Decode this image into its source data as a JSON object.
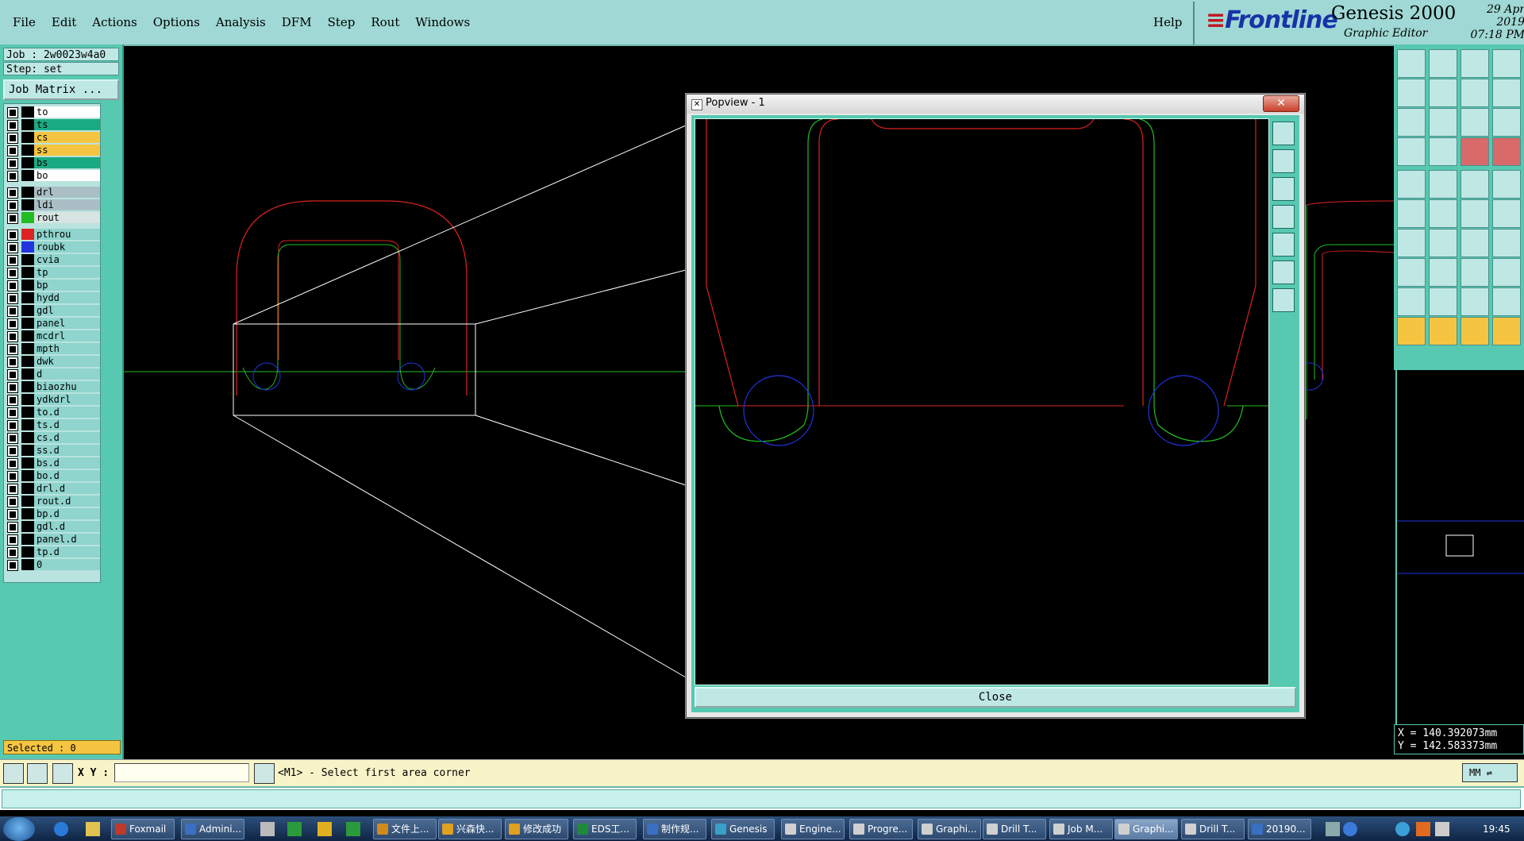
{
  "menubar": {
    "items": [
      {
        "label": "File"
      },
      {
        "label": "Edit"
      },
      {
        "label": "Actions"
      },
      {
        "label": "Options"
      },
      {
        "label": "Analysis"
      },
      {
        "label": "DFM"
      },
      {
        "label": "Step"
      },
      {
        "label": "Rout"
      },
      {
        "label": "Windows"
      }
    ],
    "help": "Help"
  },
  "brand": {
    "logo": "Frontline",
    "product": "Genesis 2000",
    "subtitle": "Graphic Editor",
    "date": "29 Apr 2019",
    "time": "07:18 PM"
  },
  "left": {
    "job": "Job : 2w0023w4a0",
    "step": "Step: set",
    "job_matrix": "Job Matrix ...",
    "layers": [
      {
        "name": "to",
        "bg": "#ffffff",
        "color": "#000000"
      },
      {
        "name": "ts",
        "bg": "#1aaa82",
        "color": "#000000"
      },
      {
        "name": "cs",
        "bg": "#f5c542",
        "color": "#000000"
      },
      {
        "name": "ss",
        "bg": "#f5c542",
        "color": "#000000"
      },
      {
        "name": "bs",
        "bg": "#1aaa82",
        "color": "#000000"
      },
      {
        "name": "bo",
        "bg": "#ffffff",
        "color": "#000000"
      },
      {
        "name": "drl",
        "bg": "#a9bfc5",
        "color": "#000000"
      },
      {
        "name": "ldi",
        "bg": "#a9bfc5",
        "color": "#000000"
      },
      {
        "name": "rout",
        "bg": "#d8e4e2",
        "color": "#22bb22"
      },
      {
        "name": "pthrou",
        "bg": "#8fd4cd",
        "color": "#dd2222"
      },
      {
        "name": "roubk",
        "bg": "#8fd4cd",
        "color": "#2233dd"
      },
      {
        "name": "cvia",
        "bg": "#8fd4cd",
        "color": "#000000"
      },
      {
        "name": "tp",
        "bg": "#8fd4cd",
        "color": "#000000"
      },
      {
        "name": "bp",
        "bg": "#8fd4cd",
        "color": "#000000"
      },
      {
        "name": "hydd",
        "bg": "#8fd4cd",
        "color": "#000000"
      },
      {
        "name": "gdl",
        "bg": "#8fd4cd",
        "color": "#000000"
      },
      {
        "name": "panel",
        "bg": "#8fd4cd",
        "color": "#000000"
      },
      {
        "name": "mcdrl",
        "bg": "#8fd4cd",
        "color": "#000000"
      },
      {
        "name": "mpth",
        "bg": "#8fd4cd",
        "color": "#000000"
      },
      {
        "name": "dwk",
        "bg": "#8fd4cd",
        "color": "#000000"
      },
      {
        "name": "d",
        "bg": "#8fd4cd",
        "color": "#000000"
      },
      {
        "name": "biaozhu",
        "bg": "#8fd4cd",
        "color": "#000000"
      },
      {
        "name": "ydkdrl",
        "bg": "#8fd4cd",
        "color": "#000000"
      },
      {
        "name": "to.d",
        "bg": "#8fd4cd",
        "color": "#000000"
      },
      {
        "name": "ts.d",
        "bg": "#8fd4cd",
        "color": "#000000"
      },
      {
        "name": "cs.d",
        "bg": "#8fd4cd",
        "color": "#000000"
      },
      {
        "name": "ss.d",
        "bg": "#8fd4cd",
        "color": "#000000"
      },
      {
        "name": "bs.d",
        "bg": "#8fd4cd",
        "color": "#000000"
      },
      {
        "name": "bo.d",
        "bg": "#8fd4cd",
        "color": "#000000"
      },
      {
        "name": "drl.d",
        "bg": "#8fd4cd",
        "color": "#000000"
      },
      {
        "name": "rout.d",
        "bg": "#8fd4cd",
        "color": "#000000"
      },
      {
        "name": "bp.d",
        "bg": "#8fd4cd",
        "color": "#000000"
      },
      {
        "name": "gdl.d",
        "bg": "#8fd4cd",
        "color": "#000000"
      },
      {
        "name": "panel.d",
        "bg": "#8fd4cd",
        "color": "#000000"
      },
      {
        "name": "tp.d",
        "bg": "#8fd4cd",
        "color": "#000000"
      },
      {
        "name": "0",
        "bg": "#8fd4cd",
        "color": "#000000"
      }
    ],
    "selected": "Selected : 0"
  },
  "popview": {
    "title": "Popview - 1",
    "close_label": "Close"
  },
  "coords": {
    "x": "X = 140.392073mm",
    "y": "Y = 142.583373mm"
  },
  "cmd": {
    "xy_label": "X Y :",
    "xy_value": "",
    "message": "<M1> - Select first area corner",
    "units": "MM"
  },
  "taskbar": {
    "tasks": [
      {
        "label": "Foxmail",
        "color": "#c0392b"
      },
      {
        "label": "Admini...",
        "color": "#3a6fc4"
      },
      {
        "label": "文件上...",
        "color": "#d08b1b"
      },
      {
        "label": "兴森快...",
        "color": "#e0a020"
      },
      {
        "label": "修改成功",
        "color": "#e0a020"
      },
      {
        "label": "EDS工...",
        "color": "#1e8a3a"
      },
      {
        "label": "制作规...",
        "color": "#3a6fc4"
      },
      {
        "label": "Genesis",
        "color": "#3aa0c8"
      },
      {
        "label": "Engine...",
        "color": "#d0d0d0"
      },
      {
        "label": "Progre...",
        "color": "#d0d0d0"
      },
      {
        "label": "Graphi...",
        "color": "#d0d0d0"
      },
      {
        "label": "Drill T...",
        "color": "#d0d0d0"
      },
      {
        "label": "Job M...",
        "color": "#d0d0d0"
      },
      {
        "label": "Graphi...",
        "color": "#d0d0d0",
        "active": true
      },
      {
        "label": "Drill T...",
        "color": "#d0d0d0"
      },
      {
        "label": "20190...",
        "color": "#3a6fc4"
      }
    ],
    "clock": "19:45"
  }
}
